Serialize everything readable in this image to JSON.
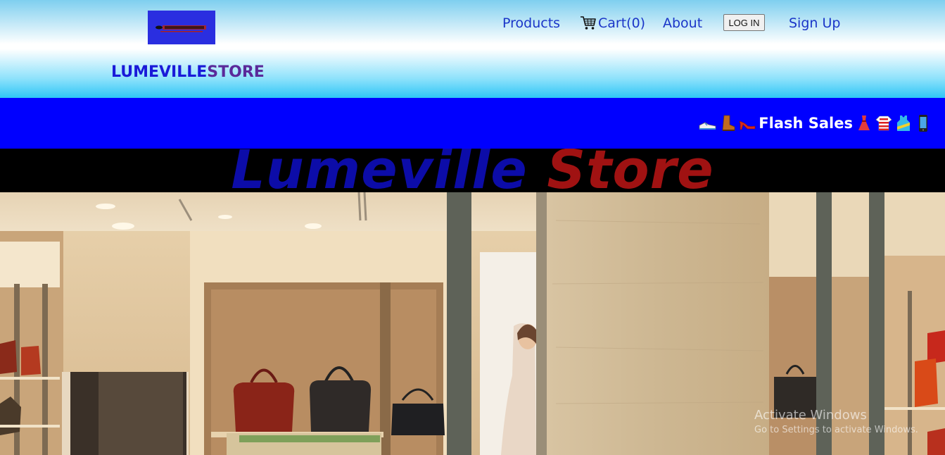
{
  "header": {
    "logo_text": "Lumeville Store",
    "brand_part1": "LUMEVILLE",
    "brand_part2": "STORE",
    "nav": {
      "products": "Products",
      "cart": "Cart(0)",
      "about": "About",
      "login": "LOG IN",
      "signup": "Sign Up"
    }
  },
  "flash": {
    "label": "Flash Sales",
    "icons_left": [
      "sneaker-icon",
      "boot-icon",
      "high-heel-icon"
    ],
    "icons_right": [
      "dress-icon",
      "shirt-icon",
      "tank-top-icon",
      "mobile-phone-icon"
    ]
  },
  "hero": {
    "title_part1": "Lumeville",
    "title_part2": "Store",
    "image": "store-interior-with-handbags"
  },
  "watermark": {
    "line1": "Activate Windows",
    "line2": "Go to Settings to activate Windows."
  },
  "colors": {
    "brand_blue": "#1a1ad8",
    "brand_purple": "#5a2a9a",
    "flash_bg": "#0000ff",
    "title_blue": "#0c0ca8",
    "title_red": "#a01212"
  }
}
